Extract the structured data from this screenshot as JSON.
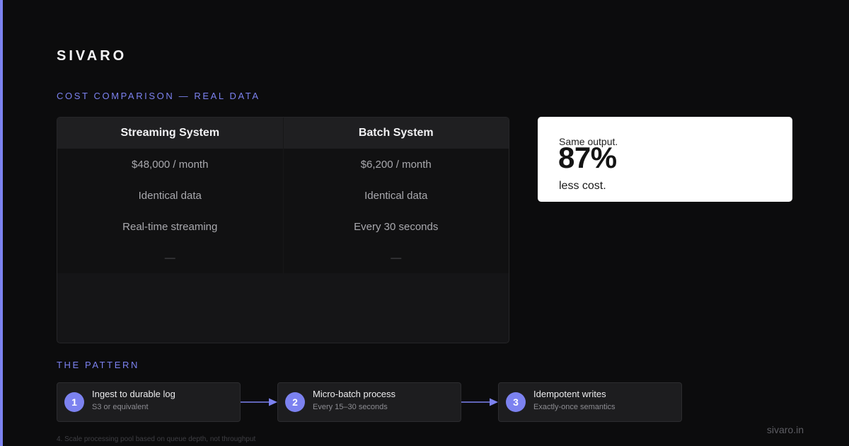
{
  "colors": {
    "accent": "#7c82f0",
    "background": "#0c0c0d",
    "card_white": "#ffffff"
  },
  "brand": "SIVARO",
  "cost_section": {
    "label": "COST COMPARISON — REAL DATA",
    "table": {
      "headers": [
        "Streaming System",
        "Batch System"
      ],
      "rows": [
        [
          "$48,000 / month",
          "$6,200 / month"
        ],
        [
          "Identical data",
          "Identical data"
        ],
        [
          "Real-time streaming",
          "Every 30 seconds"
        ],
        [
          "—",
          "—"
        ]
      ]
    }
  },
  "stat": {
    "pre": "Same output.",
    "value": "87%",
    "post": "less cost."
  },
  "pattern": {
    "label": "THE PATTERN",
    "steps": [
      {
        "number": "1",
        "title": "Ingest to durable log",
        "subtitle": "S3 or equivalent"
      },
      {
        "number": "2",
        "title": "Micro-batch process",
        "subtitle": "Every 15–30 seconds"
      },
      {
        "number": "3",
        "title": "Idempotent writes",
        "subtitle": "Exactly-once semantics"
      }
    ],
    "footnote": "4. Scale processing pool based on queue depth, not throughput"
  },
  "footer": {
    "site": "sivaro.in"
  }
}
